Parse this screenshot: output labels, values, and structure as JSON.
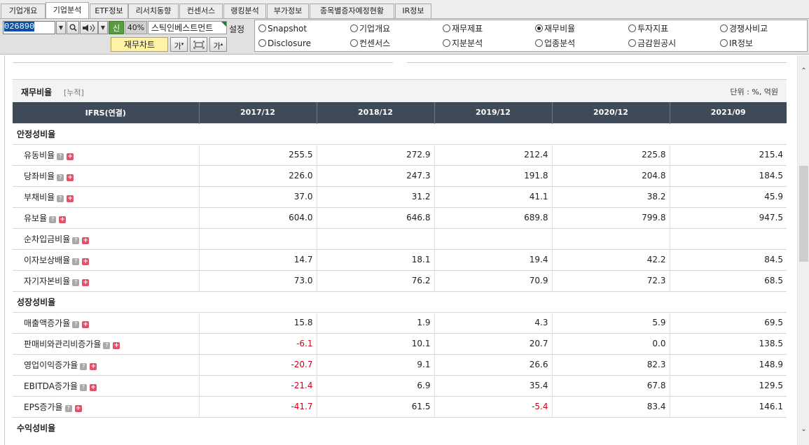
{
  "tabs": [
    {
      "label": "기업개요",
      "active": false
    },
    {
      "label": "기업분석",
      "active": true
    },
    {
      "label": "ETF정보",
      "active": false
    },
    {
      "label": "리서치동향",
      "active": false
    },
    {
      "label": "컨센서스",
      "active": false
    },
    {
      "label": "랭킹분석",
      "active": false
    },
    {
      "label": "부가정보",
      "active": false
    },
    {
      "label": "종목별증자예정현황",
      "active": false
    },
    {
      "label": "IR정보",
      "active": false
    }
  ],
  "toolbar": {
    "stock_code": "026890",
    "badge": "신",
    "percent": "40%",
    "company": "스틱인베스트먼트",
    "settings_label": "설정",
    "chart_button": "재무차트",
    "font_up_label": "가",
    "font_down_label": "가"
  },
  "radio_options": [
    {
      "label": "Snapshot",
      "selected": false
    },
    {
      "label": "기업개요",
      "selected": false
    },
    {
      "label": "재무제표",
      "selected": false
    },
    {
      "label": "재무비율",
      "selected": true
    },
    {
      "label": "투자지표",
      "selected": false
    },
    {
      "label": "경쟁사비교",
      "selected": false
    },
    {
      "label": "Disclosure",
      "selected": false
    },
    {
      "label": "컨센서스",
      "selected": false
    },
    {
      "label": "지분분석",
      "selected": false
    },
    {
      "label": "업종분석",
      "selected": false
    },
    {
      "label": "금감원공시",
      "selected": false
    },
    {
      "label": "IR정보",
      "selected": false
    }
  ],
  "section": {
    "title": "재무비율",
    "subtitle": "[누적]",
    "unit": "단위 : %, 억원"
  },
  "table": {
    "headers": [
      "IFRS(연결)",
      "2017/12",
      "2018/12",
      "2019/12",
      "2020/12",
      "2021/09"
    ],
    "rows": [
      {
        "group": true,
        "label": "안정성비율"
      },
      {
        "label": "유동비율",
        "values": [
          "255.5",
          "272.9",
          "212.4",
          "225.8",
          "215.4"
        ]
      },
      {
        "label": "당좌비율",
        "values": [
          "226.0",
          "247.3",
          "191.8",
          "204.8",
          "184.5"
        ]
      },
      {
        "label": "부채비율",
        "values": [
          "37.0",
          "31.2",
          "41.1",
          "38.2",
          "45.9"
        ]
      },
      {
        "label": "유보율",
        "values": [
          "604.0",
          "646.8",
          "689.8",
          "799.8",
          "947.5"
        ]
      },
      {
        "label": "순차입금비율",
        "values": [
          "",
          "",
          "",
          "",
          ""
        ]
      },
      {
        "label": "이자보상배율",
        "values": [
          "14.7",
          "18.1",
          "19.4",
          "42.2",
          "84.5"
        ]
      },
      {
        "label": "자기자본비율",
        "values": [
          "73.0",
          "76.2",
          "70.9",
          "72.3",
          "68.5"
        ]
      },
      {
        "group": true,
        "label": "성장성비율"
      },
      {
        "label": "매출액증가율",
        "values": [
          "15.8",
          "1.9",
          "4.3",
          "5.9",
          "69.5"
        ]
      },
      {
        "label": "판매비와관리비증가율",
        "values": [
          "-6.1",
          "10.1",
          "20.7",
          "0.0",
          "138.5"
        ]
      },
      {
        "label": "영업이익증가율",
        "values": [
          "-20.7",
          "9.1",
          "26.6",
          "82.3",
          "148.9"
        ]
      },
      {
        "label": "EBITDA증가율",
        "values": [
          "-21.4",
          "6.9",
          "35.4",
          "67.8",
          "129.5"
        ]
      },
      {
        "label": "EPS증가율",
        "values": [
          "-41.7",
          "61.5",
          "-5.4",
          "83.4",
          "146.1"
        ]
      },
      {
        "group": true,
        "label": "수익성비율"
      }
    ]
  },
  "colors": {
    "header_bg": "#3f4a59",
    "negative": "#d0021b",
    "chart_button_bg": "#fff3a8",
    "badge_bg": "#5a9a40"
  }
}
